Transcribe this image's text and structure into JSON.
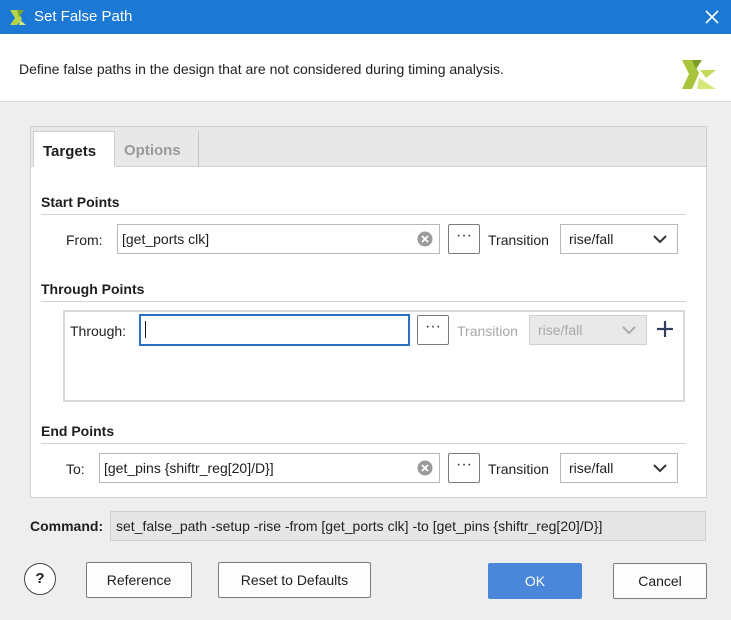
{
  "window": {
    "title": "Set False Path",
    "description": "Define false paths in the design that are not considered during timing analysis."
  },
  "tabs": [
    {
      "label": "Targets",
      "active": true
    },
    {
      "label": "Options",
      "active": false
    }
  ],
  "start_points": {
    "title": "Start Points",
    "from_label": "From:",
    "from_value": "[get_ports clk]",
    "transition_label": "Transition",
    "transition_value": "rise/fall"
  },
  "through_points": {
    "title": "Through Points",
    "through_label": "Through:",
    "through_value": "",
    "transition_label": "Transition",
    "transition_value": "rise/fall"
  },
  "end_points": {
    "title": "End Points",
    "to_label": "To:",
    "to_value": "[get_pins {shiftr_reg[20]/D}]",
    "transition_label": "Transition",
    "transition_value": "rise/fall"
  },
  "browse_label": "···",
  "command": {
    "label": "Command:",
    "text": "set_false_path -setup -rise -from [get_ports clk] -to [get_pins {shiftr_reg[20]/D}]"
  },
  "buttons": {
    "help": "?",
    "reference": "Reference",
    "reset": "Reset to Defaults",
    "ok": "OK",
    "cancel": "Cancel"
  },
  "colors": {
    "title_bar": "#1b78d4",
    "primary_button": "#4a86d9",
    "focus_border": "#2d70c6",
    "brand_green": "#a7c43b"
  }
}
